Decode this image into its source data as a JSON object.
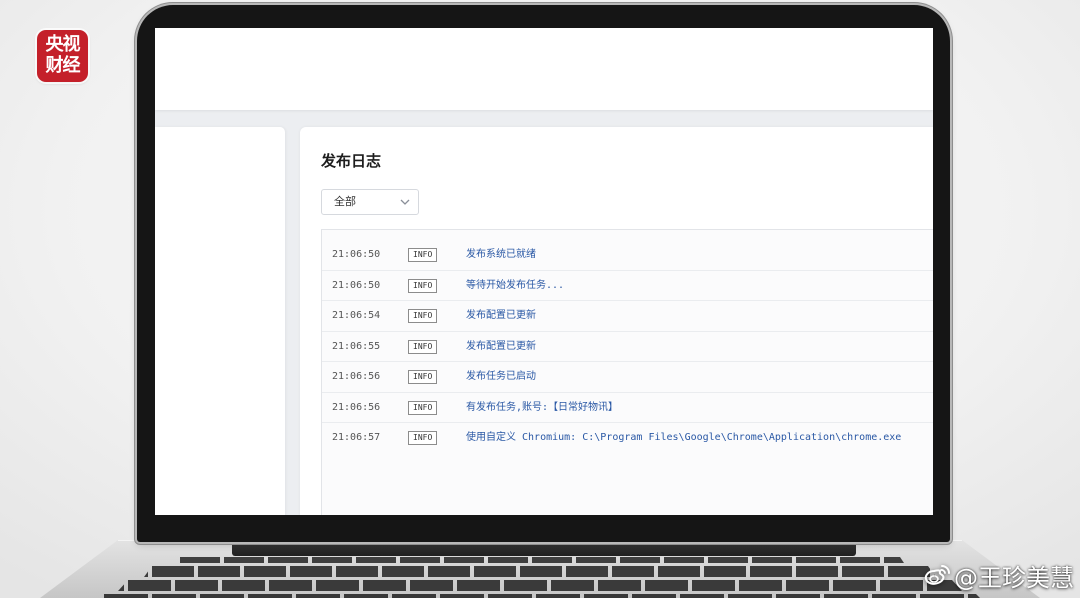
{
  "colors": {
    "logo_red": "#c4202a",
    "log_message": "#2a58a5",
    "log_time": "#555555",
    "laptop_bezel": "#151515"
  },
  "overlay": {
    "logo": {
      "line1": "央视",
      "line2": "财经"
    },
    "watermark": {
      "icon": "weibo-icon",
      "text": "@王珍美慧"
    }
  },
  "laptop": {
    "app": {
      "log_panel": {
        "title": "发布日志",
        "filter": {
          "selected": "全部",
          "icon": "chevron-down-icon"
        },
        "entries": [
          {
            "time": "21:06:50",
            "level": "INFO",
            "message": "发布系统已就绪"
          },
          {
            "time": "21:06:50",
            "level": "INFO",
            "message": "等待开始发布任务..."
          },
          {
            "time": "21:06:54",
            "level": "INFO",
            "message": "发布配置已更新"
          },
          {
            "time": "21:06:55",
            "level": "INFO",
            "message": "发布配置已更新"
          },
          {
            "time": "21:06:56",
            "level": "INFO",
            "message": "发布任务已启动"
          },
          {
            "time": "21:06:56",
            "level": "INFO",
            "message": "有发布任务,账号:【日常好物讯】"
          },
          {
            "time": "21:06:57",
            "level": "INFO",
            "message": "使用自定义 Chromium: C:\\Program Files\\Google\\Chrome\\Application\\chrome.exe"
          }
        ]
      }
    }
  }
}
